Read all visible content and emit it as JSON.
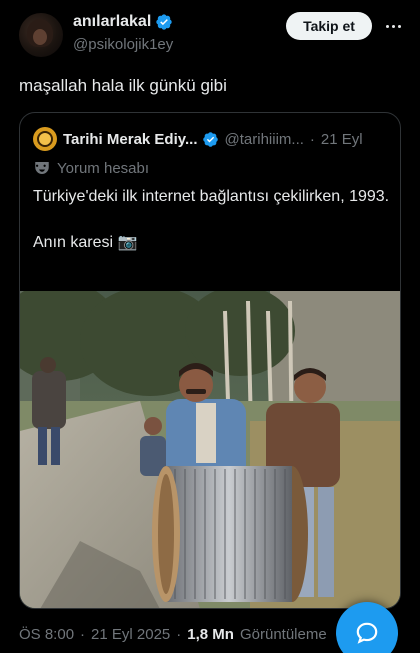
{
  "author": {
    "display_name": "anılarlakal",
    "handle": "@psikolojik1ey",
    "verified": true
  },
  "follow_button": {
    "label": "Takip et"
  },
  "tweet": {
    "text": "maşallah hala ilk günkü gibi"
  },
  "quoted_tweet": {
    "display_name": "Tarihi Merak Ediy...",
    "handle": "@tarihiiim...",
    "separator": "·",
    "time": "21 Eyl",
    "label": "Yorum hesabı",
    "text": "Türkiye'deki ilk internet bağlantısı çekilirken, 1993.\n\nAnın karesi 📷"
  },
  "footer": {
    "time": "ÖS 8:00",
    "separator1": "·",
    "date": "21 Eyl 2025",
    "separator2": "·",
    "views_count": "1,8 Mn",
    "views_label": "Görüntüleme"
  },
  "colors": {
    "accent": "#1d9bf0",
    "background": "#000000",
    "secondary_text": "#71767b",
    "border": "#2f3336"
  },
  "icons": {
    "more": "more-horizontal-icon",
    "verified": "verified-badge-icon",
    "label": "theater-mask-icon",
    "compose": "reply-bubble-icon"
  }
}
